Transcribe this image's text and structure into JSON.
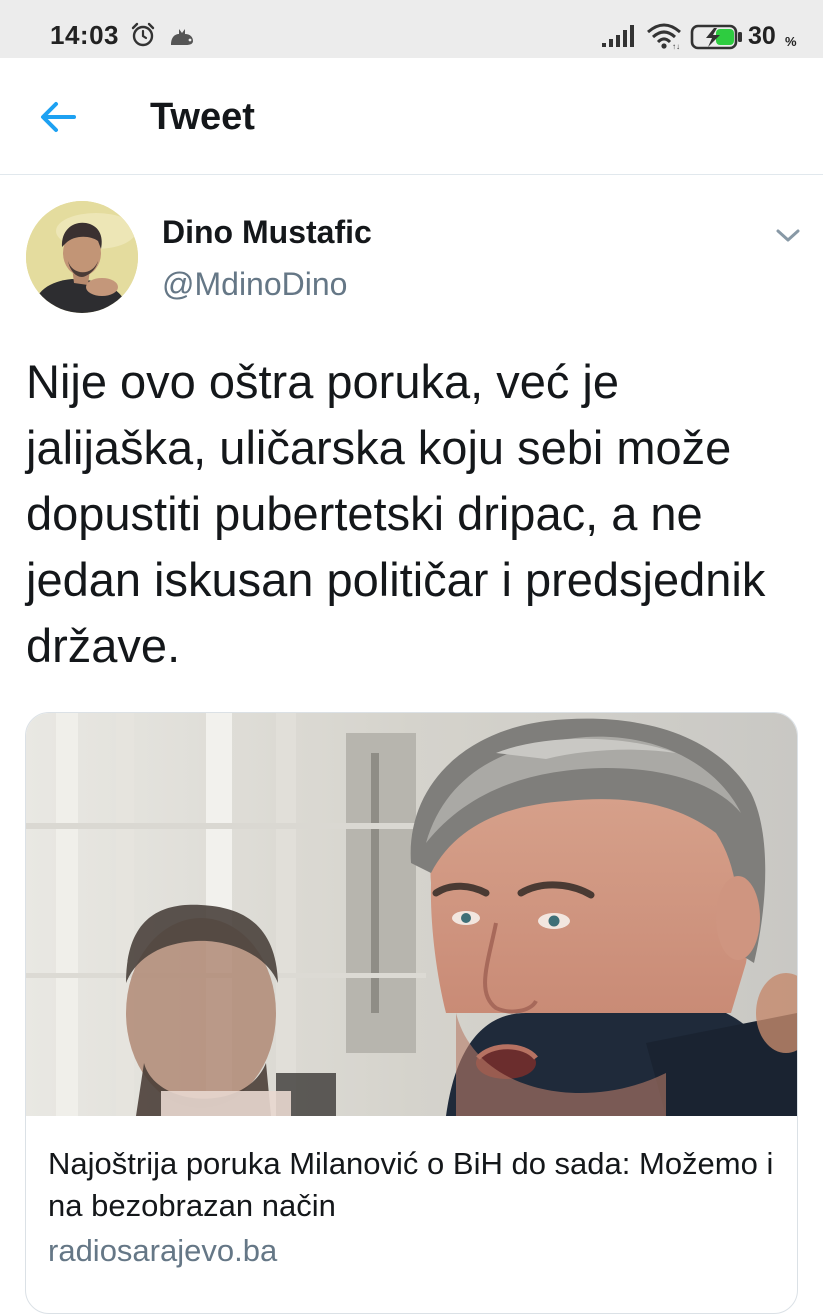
{
  "status_bar": {
    "time": "14:03",
    "alarm_icon": "alarm-clock-icon",
    "notification_icon": "cat-icon",
    "signal_icon": "signal-bars-icon",
    "wifi_icon": "wifi-icon",
    "battery_icon": "battery-charging-icon",
    "battery_percent": "30",
    "battery_unit": "%"
  },
  "header": {
    "back_icon": "arrow-left-icon",
    "title": "Tweet"
  },
  "tweet": {
    "author_name": "Dino Mustafic",
    "author_handle": "@MdinoDino",
    "menu_icon": "chevron-down-icon",
    "text": "Nije ovo oštra poruka, već je jalijaška, uličarska koju sebi može dopustiti pubertetski dripac, a ne jedan iskusan političar i predsjednik države."
  },
  "link_card": {
    "title": "Najoštrija poruka Milanović o BiH do sada: Možemo i na bezobrazan način",
    "domain": "radiosarajevo.ba"
  },
  "colors": {
    "accent": "#1da1f2",
    "text_primary": "#14171a",
    "text_secondary": "#657786",
    "status_bar_bg": "#ececec",
    "battery_charge": "#2ecc40"
  }
}
